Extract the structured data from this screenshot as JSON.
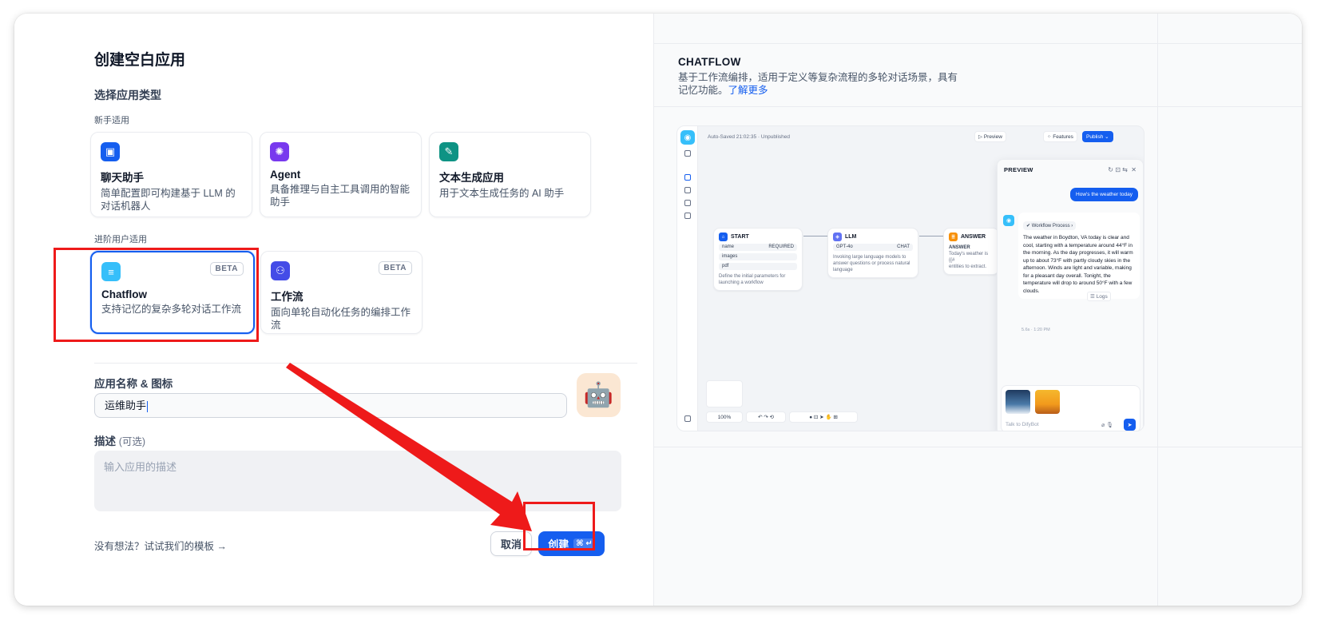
{
  "dialog": {
    "title": "创建空白应用",
    "select_type_label": "选择应用类型",
    "beginner_label": "新手适用",
    "advanced_label": "进阶用户适用"
  },
  "app_types": {
    "chatbot": {
      "name": "聊天助手",
      "desc": "简单配置即可构建基于 LLM 的对话机器人",
      "icon": "chat-bot-icon",
      "color": "#155eef"
    },
    "agent": {
      "name": "Agent",
      "desc": "具备推理与自主工具调用的智能助手",
      "icon": "agent-icon",
      "color": "#7839ee"
    },
    "completion": {
      "name": "文本生成应用",
      "desc": "用于文本生成任务的 AI 助手",
      "icon": "text-generation-icon",
      "color": "#0e9384"
    },
    "chatflow": {
      "name": "Chatflow",
      "desc": "支持记忆的复杂多轮对话工作流",
      "badge": "BETA",
      "icon": "chatflow-icon",
      "color": "#36bffa"
    },
    "workflow": {
      "name": "工作流",
      "desc": "面向单轮自动化任务的编排工作流",
      "badge": "BETA",
      "icon": "workflow-icon",
      "color": "#444ce7"
    }
  },
  "form": {
    "name_label": "应用名称 & 图标",
    "name_value": "运维助手",
    "app_icon": "🤖",
    "desc_label": "描述",
    "desc_optional": "(可选)",
    "desc_placeholder": "输入应用的描述"
  },
  "footer": {
    "template_link": "没有想法？试试我们的模板",
    "cancel_label": "取消",
    "create_label": "创建",
    "create_shortcut": "⌘ ↵"
  },
  "preview_panel": {
    "type_title": "CHATFLOW",
    "type_desc": "基于工作流编排，适用于定义等复杂流程的多轮对话场景，具有记忆功能。",
    "learn_more": "了解更多",
    "screenshot": {
      "autosave": "Auto-Saved 21:02:35 · Unpublished",
      "preview_btn": "Preview",
      "features_btn": "Features",
      "publish_btn": "Publish",
      "zoom": "100%",
      "start_node": {
        "title": "START",
        "vars": [
          "name",
          "images",
          "pdf"
        ],
        "required": "REQUIRED",
        "desc": "Define the initial parameters for launching a workflow"
      },
      "llm_node": {
        "title": "LLM",
        "model": "GPT-4o",
        "mode": "CHAT",
        "desc": "Invoking large language models to answer questions or process natural language"
      },
      "answer_node": {
        "title": "ANSWER",
        "label": "ANSWER",
        "text": "Today's weather is {{#",
        "text2": "entities to extract."
      },
      "chat": {
        "title": "PREVIEW",
        "user_msg": "How's the weather today",
        "workflow_process": "Workflow Process",
        "bot_msg": "The weather in Boydton, VA today is clear and cool, starting with a temperature around 44°F in the morning. As the day progresses, it will warm up to about 73°F with partly cloudy skies in the afternoon. Winds are light and variable, making for a pleasant day overall. Tonight, the temperature will drop to around 50°F with a few clouds.",
        "meta": "5.6s · 1:20 PM",
        "logs": "Logs",
        "input_placeholder": "Talk to DifyBot"
      }
    }
  }
}
